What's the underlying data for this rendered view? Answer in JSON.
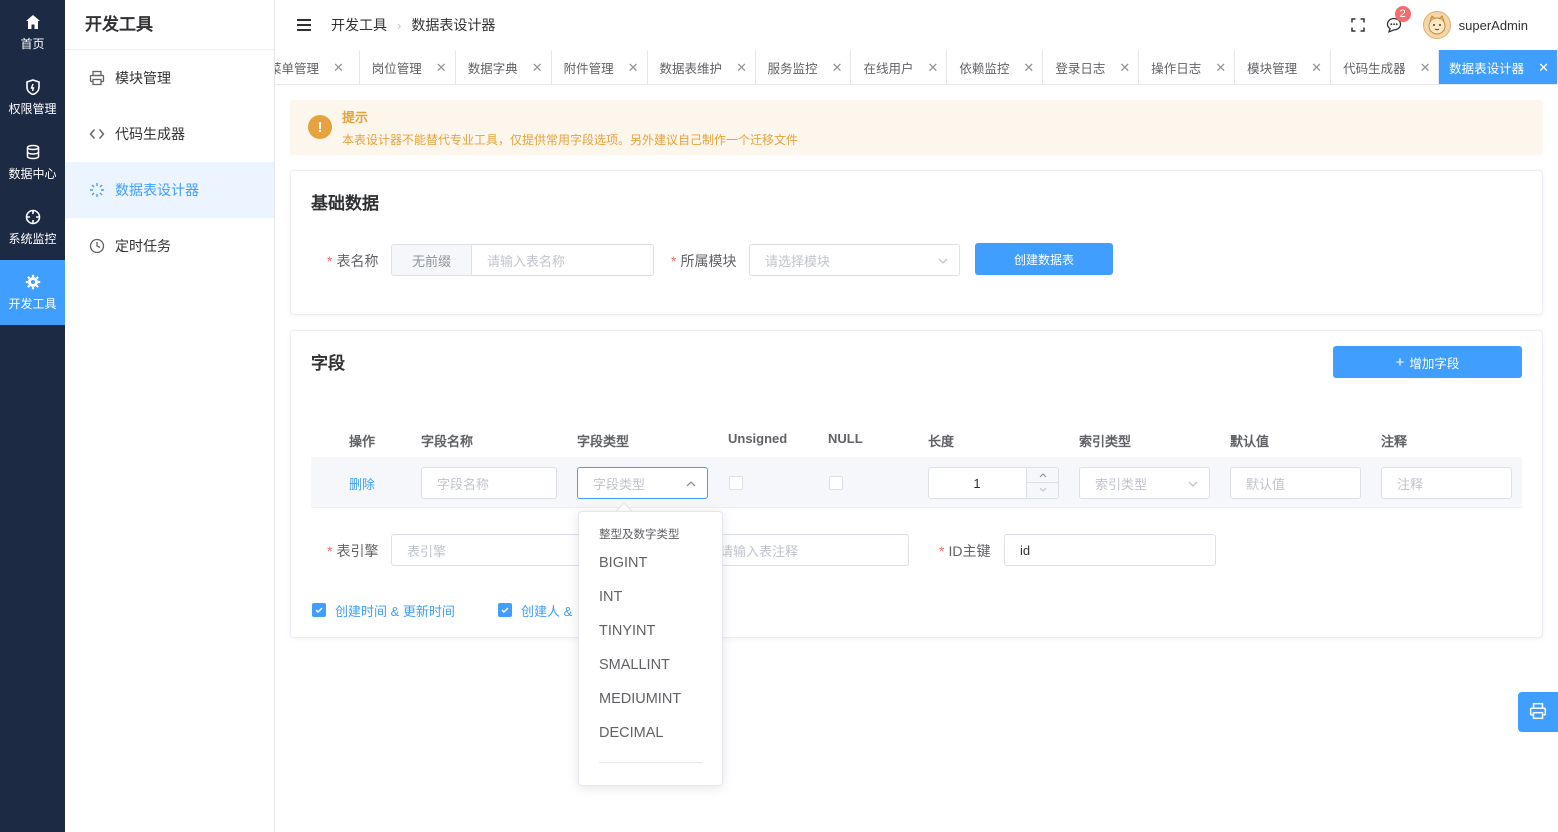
{
  "rail": [
    {
      "label": "首页",
      "icon": "home-icon"
    },
    {
      "label": "权限管理",
      "icon": "shield-icon"
    },
    {
      "label": "数据中心",
      "icon": "database-icon"
    },
    {
      "label": "系统监控",
      "icon": "crosshair-icon"
    },
    {
      "label": "开发工具",
      "icon": "gear-icon"
    }
  ],
  "subnav": {
    "title": "开发工具",
    "items": [
      {
        "label": "模块管理",
        "icon": "printer-icon"
      },
      {
        "label": "代码生成器",
        "icon": "code-icon"
      },
      {
        "label": "数据表设计器",
        "icon": "loading-icon"
      },
      {
        "label": "定时任务",
        "icon": "clock-icon"
      }
    ]
  },
  "header": {
    "breadcrumb": [
      "开发工具",
      "数据表设计器"
    ],
    "notification_count": "2",
    "username": "superAdmin"
  },
  "tabs": [
    {
      "label": "菜单管理",
      "display": "菜单管理"
    },
    {
      "label": "岗位管理"
    },
    {
      "label": "数据字典"
    },
    {
      "label": "附件管理"
    },
    {
      "label": "数据表维护"
    },
    {
      "label": "服务监控"
    },
    {
      "label": "在线用户"
    },
    {
      "label": "依赖监控"
    },
    {
      "label": "登录日志"
    },
    {
      "label": "操作日志"
    },
    {
      "label": "模块管理"
    },
    {
      "label": "代码生成器"
    },
    {
      "label": "数据表设计器"
    }
  ],
  "alert": {
    "title": "提示",
    "desc": "本表设计器不能替代专业工具，仅提供常用字段选项。另外建议自己制作一个迁移文件"
  },
  "basic": {
    "title": "基础数据",
    "table_name_label": "表名称",
    "prefix": "无前缀",
    "table_name_placeholder": "请输入表名称",
    "module_label": "所属模块",
    "module_placeholder": "请选择模块",
    "create_button": "创建数据表"
  },
  "fields": {
    "title": "字段",
    "add_button": "增加字段",
    "columns": [
      "操作",
      "字段名称",
      "字段类型",
      "Unsigned",
      "NULL",
      "长度",
      "索引类型",
      "默认值",
      "注释"
    ],
    "row": {
      "action": "删除",
      "name_placeholder": "字段名称",
      "type_placeholder": "字段类型",
      "length": "1",
      "index_placeholder": "索引类型",
      "default_placeholder": "默认值",
      "comment_placeholder": "注释"
    },
    "engine_label": "表引擎",
    "engine_placeholder": "表引擎",
    "table_comment_placeholder": "请输入表注释",
    "pk_label": "ID主键",
    "pk_value": "id",
    "opt_timestamps": "创建时间 & 更新时间",
    "opt_creator": "创建人 & "
  },
  "dropdown": {
    "group": "整型及数字类型",
    "options": [
      "BIGINT",
      "INT",
      "TINYINT",
      "SMALLINT",
      "MEDIUMINT",
      "DECIMAL"
    ]
  },
  "colors": {
    "primary": "#409eff",
    "rail": "#1d2a44",
    "warning": "#e6a23c"
  }
}
